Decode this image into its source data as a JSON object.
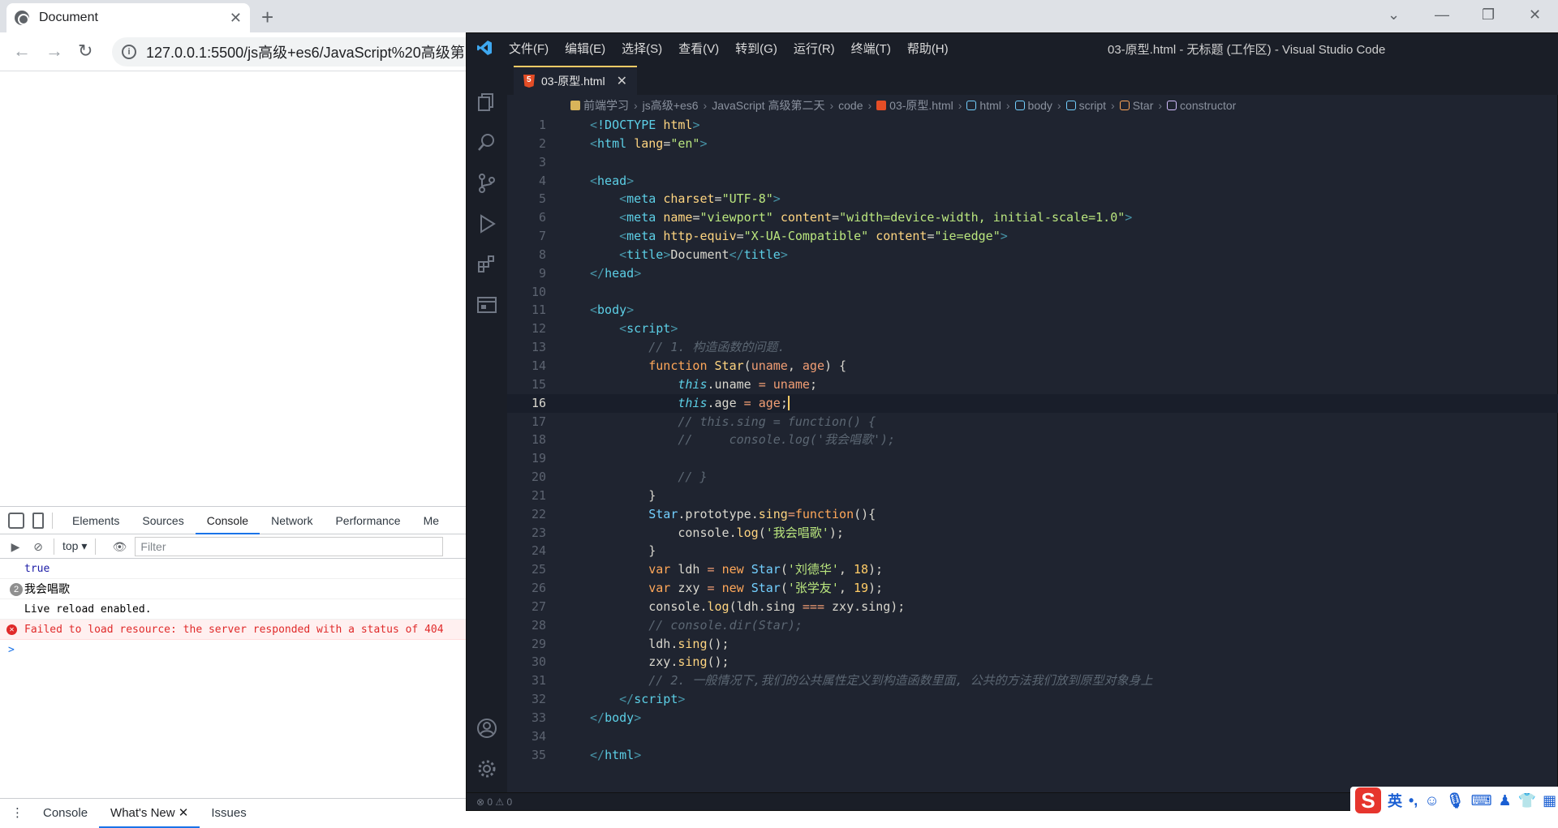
{
  "browser": {
    "tab_title": "Document",
    "url": "127.0.0.1:5500/js高级+es6/JavaScript%20高级第",
    "devtools": {
      "tabs": [
        "Elements",
        "Sources",
        "Console",
        "Network",
        "Performance",
        "Me"
      ],
      "active_tab": "Console",
      "context": "top",
      "filter_placeholder": "Filter",
      "console_lines": [
        {
          "type": "true",
          "text": "true"
        },
        {
          "type": "group",
          "count": "2",
          "text": "我会唱歌"
        },
        {
          "type": "log",
          "text": "Live reload enabled."
        },
        {
          "type": "error",
          "text": "Failed to load resource: the server responded with a status of 404"
        }
      ],
      "prompt": ">",
      "drawer_tabs": [
        "Console",
        "What's New",
        "Issues"
      ],
      "drawer_active": "What's New"
    }
  },
  "vscode": {
    "menu": [
      "文件(F)",
      "编辑(E)",
      "选择(S)",
      "查看(V)",
      "转到(G)",
      "运行(R)",
      "终端(T)",
      "帮助(H)"
    ],
    "window_title": "03-原型.html - 无标题 (工作区) - Visual Studio Code",
    "open_tab": "03-原型.html",
    "breadcrumb": [
      "前端学习",
      "js高级+es6",
      "JavaScript 高级第二天",
      "code",
      "03-原型.html",
      "html",
      "body",
      "script",
      "Star",
      "constructor"
    ],
    "current_line": 16,
    "status": "⊗ 0 ⚠ 0",
    "accent": "#ffcc66"
  },
  "code_lines": [
    [
      [
        "t-punc",
        "<"
      ],
      [
        "t-tag",
        "!DOCTYPE "
      ],
      [
        "t-attr",
        "html"
      ],
      [
        "t-punc",
        ">"
      ]
    ],
    [
      [
        "t-punc",
        "<"
      ],
      [
        "t-tag",
        "html "
      ],
      [
        "t-attr",
        "lang"
      ],
      [
        "t-par",
        "="
      ],
      [
        "t-str",
        "\"en\""
      ],
      [
        "t-punc",
        ">"
      ]
    ],
    [],
    [
      [
        "t-punc",
        "<"
      ],
      [
        "t-tag",
        "head"
      ],
      [
        "t-punc",
        ">"
      ]
    ],
    [
      [
        "",
        "    "
      ],
      [
        "t-punc",
        "<"
      ],
      [
        "t-tag",
        "meta "
      ],
      [
        "t-attr",
        "charset"
      ],
      [
        "t-par",
        "="
      ],
      [
        "t-str",
        "\"UTF-8\""
      ],
      [
        "t-punc",
        ">"
      ]
    ],
    [
      [
        "",
        "    "
      ],
      [
        "t-punc",
        "<"
      ],
      [
        "t-tag",
        "meta "
      ],
      [
        "t-attr",
        "name"
      ],
      [
        "t-par",
        "="
      ],
      [
        "t-str",
        "\"viewport\" "
      ],
      [
        "t-attr",
        "content"
      ],
      [
        "t-par",
        "="
      ],
      [
        "t-str",
        "\"width=device-width, initial-scale=1.0\""
      ],
      [
        "t-punc",
        ">"
      ]
    ],
    [
      [
        "",
        "    "
      ],
      [
        "t-punc",
        "<"
      ],
      [
        "t-tag",
        "meta "
      ],
      [
        "t-attr",
        "http-equiv"
      ],
      [
        "t-par",
        "="
      ],
      [
        "t-str",
        "\"X-UA-Compatible\" "
      ],
      [
        "t-attr",
        "content"
      ],
      [
        "t-par",
        "="
      ],
      [
        "t-str",
        "\"ie=edge\""
      ],
      [
        "t-punc",
        ">"
      ]
    ],
    [
      [
        "",
        "    "
      ],
      [
        "t-punc",
        "<"
      ],
      [
        "t-tag",
        "title"
      ],
      [
        "t-punc",
        ">"
      ],
      [
        "t-par",
        "Document"
      ],
      [
        "t-punc",
        "</"
      ],
      [
        "t-tag",
        "title"
      ],
      [
        "t-punc",
        ">"
      ]
    ],
    [
      [
        "t-punc",
        "</"
      ],
      [
        "t-tag",
        "head"
      ],
      [
        "t-punc",
        ">"
      ]
    ],
    [],
    [
      [
        "t-punc",
        "<"
      ],
      [
        "t-tag",
        "body"
      ],
      [
        "t-punc",
        ">"
      ]
    ],
    [
      [
        "",
        "    "
      ],
      [
        "t-punc",
        "<"
      ],
      [
        "t-tag",
        "script"
      ],
      [
        "t-punc",
        ">"
      ]
    ],
    [
      [
        "",
        "        "
      ],
      [
        "t-cm",
        "// 1. 构造函数的问题."
      ]
    ],
    [
      [
        "",
        "        "
      ],
      [
        "t-kw",
        "function "
      ],
      [
        "t-fn",
        "Star"
      ],
      [
        "t-par",
        "("
      ],
      [
        "t-prop",
        "uname"
      ],
      [
        "t-par",
        ", "
      ],
      [
        "t-prop",
        "age"
      ],
      [
        "t-par",
        ") {"
      ]
    ],
    [
      [
        "",
        "            "
      ],
      [
        "t-this",
        "this"
      ],
      [
        "t-par",
        "."
      ],
      [
        "t-par",
        "uname "
      ],
      [
        "t-op",
        "= "
      ],
      [
        "t-prop",
        "uname"
      ],
      [
        "t-par",
        ";"
      ]
    ],
    [
      [
        "",
        "            "
      ],
      [
        "t-this",
        "this"
      ],
      [
        "t-par",
        "."
      ],
      [
        "t-par",
        "age "
      ],
      [
        "t-op",
        "= "
      ],
      [
        "t-prop",
        "age"
      ],
      [
        "t-par",
        ";"
      ],
      [
        "cursor",
        ""
      ]
    ],
    [
      [
        "",
        "            "
      ],
      [
        "t-cm",
        "// this.sing = function() {"
      ]
    ],
    [
      [
        "",
        "            "
      ],
      [
        "t-cm",
        "//     console.log('我会唱歌');"
      ]
    ],
    [],
    [
      [
        "",
        "            "
      ],
      [
        "t-cm",
        "// }"
      ]
    ],
    [
      [
        "",
        "        "
      ],
      [
        "t-par",
        "}"
      ]
    ],
    [
      [
        "",
        "        "
      ],
      [
        "t-cls",
        "Star"
      ],
      [
        "t-par",
        "."
      ],
      [
        "t-par",
        "prototype"
      ],
      [
        "t-par",
        "."
      ],
      [
        "t-fn",
        "sing"
      ],
      [
        "t-op",
        "="
      ],
      [
        "t-kw",
        "function"
      ],
      [
        "t-par",
        "(){"
      ]
    ],
    [
      [
        "",
        "            "
      ],
      [
        "t-par",
        "console"
      ],
      [
        "t-par",
        "."
      ],
      [
        "t-fn",
        "log"
      ],
      [
        "t-par",
        "("
      ],
      [
        "t-str",
        "'我会唱歌'"
      ],
      [
        "t-par",
        ");"
      ]
    ],
    [
      [
        "",
        "        "
      ],
      [
        "t-par",
        "}"
      ]
    ],
    [
      [
        "",
        "        "
      ],
      [
        "t-kw",
        "var "
      ],
      [
        "t-par",
        "ldh "
      ],
      [
        "t-op",
        "= "
      ],
      [
        "t-kw",
        "new "
      ],
      [
        "t-cls",
        "Star"
      ],
      [
        "t-par",
        "("
      ],
      [
        "t-str",
        "'刘德华'"
      ],
      [
        "t-par",
        ", "
      ],
      [
        "t-num",
        "18"
      ],
      [
        "t-par",
        ");"
      ]
    ],
    [
      [
        "",
        "        "
      ],
      [
        "t-kw",
        "var "
      ],
      [
        "t-par",
        "zxy "
      ],
      [
        "t-op",
        "= "
      ],
      [
        "t-kw",
        "new "
      ],
      [
        "t-cls",
        "Star"
      ],
      [
        "t-par",
        "("
      ],
      [
        "t-str",
        "'张学友'"
      ],
      [
        "t-par",
        ", "
      ],
      [
        "t-num",
        "19"
      ],
      [
        "t-par",
        ");"
      ]
    ],
    [
      [
        "",
        "        "
      ],
      [
        "t-par",
        "console"
      ],
      [
        "t-par",
        "."
      ],
      [
        "t-fn",
        "log"
      ],
      [
        "t-par",
        "(ldh.sing "
      ],
      [
        "t-op",
        "=== "
      ],
      [
        "t-par",
        "zxy.sing);"
      ]
    ],
    [
      [
        "",
        "        "
      ],
      [
        "t-cm",
        "// console.dir(Star);"
      ]
    ],
    [
      [
        "",
        "        "
      ],
      [
        "t-par",
        "ldh."
      ],
      [
        "t-fn",
        "sing"
      ],
      [
        "t-par",
        "();"
      ]
    ],
    [
      [
        "",
        "        "
      ],
      [
        "t-par",
        "zxy."
      ],
      [
        "t-fn",
        "sing"
      ],
      [
        "t-par",
        "();"
      ]
    ],
    [
      [
        "",
        "        "
      ],
      [
        "t-cm",
        "// 2. 一般情况下,我们的公共属性定义到构造函数里面, 公共的方法我们放到原型对象身上"
      ]
    ],
    [
      [
        "",
        "    "
      ],
      [
        "t-punc",
        "</"
      ],
      [
        "t-tag",
        "script"
      ],
      [
        "t-punc",
        ">"
      ]
    ],
    [
      [
        "t-punc",
        "</"
      ],
      [
        "t-tag",
        "body"
      ],
      [
        "t-punc",
        ">"
      ]
    ],
    [],
    [
      [
        "t-punc",
        "</"
      ],
      [
        "t-tag",
        "html"
      ],
      [
        "t-punc",
        ">"
      ]
    ]
  ],
  "ime": {
    "logo": "S",
    "items": [
      "英",
      "•,",
      "☺",
      "🎙",
      "⌨",
      "♟",
      "👕",
      "▦"
    ]
  }
}
